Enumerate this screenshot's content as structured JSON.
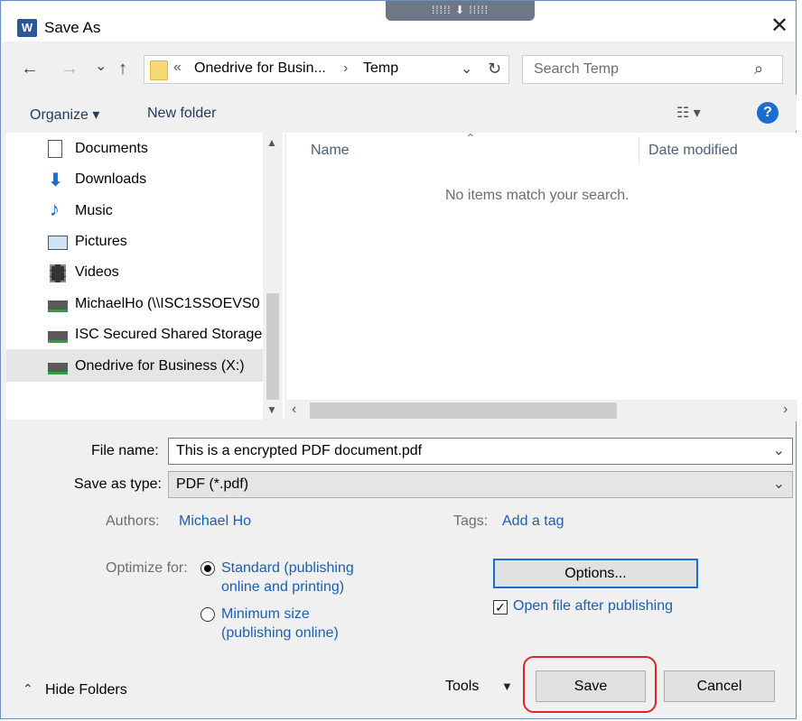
{
  "window": {
    "title": "Save As",
    "app_icon_letter": "W"
  },
  "nav_buttons": {
    "back": "←",
    "forward": "→",
    "recent": "⌄",
    "up": "↑"
  },
  "address": {
    "prefix": "«",
    "crumbs": [
      "Onedrive for Busin...",
      "Temp"
    ],
    "separator": "›"
  },
  "search": {
    "placeholder": "Search Temp"
  },
  "toolbar": {
    "organize": "Organize ▾",
    "new_folder": "New folder"
  },
  "sidebar": {
    "items": [
      {
        "label": "Documents",
        "icon": "documents-icon"
      },
      {
        "label": "Downloads",
        "icon": "downloads-icon"
      },
      {
        "label": "Music",
        "icon": "music-icon"
      },
      {
        "label": "Pictures",
        "icon": "pictures-icon"
      },
      {
        "label": "Videos",
        "icon": "videos-icon"
      },
      {
        "label": "MichaelHo (\\\\ISC1SSOEVS0",
        "icon": "network-drive-icon"
      },
      {
        "label": "ISC Secured Shared Storage",
        "icon": "network-drive-icon"
      },
      {
        "label": "Onedrive for Business (X:)",
        "icon": "network-drive-icon",
        "selected": true
      }
    ]
  },
  "file_list": {
    "columns": [
      "Name",
      "Date modified"
    ],
    "empty_message": "No items match your search."
  },
  "form": {
    "file_name_label": "File name:",
    "file_name_value": "This is a encrypted PDF document.pdf",
    "save_type_label": "Save as type:",
    "save_type_value": "PDF (*.pdf)",
    "authors_label": "Authors:",
    "authors_value": "Michael Ho",
    "tags_label": "Tags:",
    "tags_value": "Add a tag",
    "optimize_label": "Optimize for:",
    "opt_standard_line1": "Standard (publishing",
    "opt_standard_line2": "online and printing)",
    "opt_minimum_line1": "Minimum size",
    "opt_minimum_line2": "(publishing online)",
    "options_button": "Options...",
    "open_after_label": "Open file after publishing"
  },
  "footer": {
    "hide_folders": "Hide Folders",
    "tools": "Tools",
    "save": "Save",
    "cancel": "Cancel"
  },
  "colors": {
    "accent": "#1a5fb4",
    "highlight": "#d8262e",
    "help": "#1a6ed1"
  }
}
